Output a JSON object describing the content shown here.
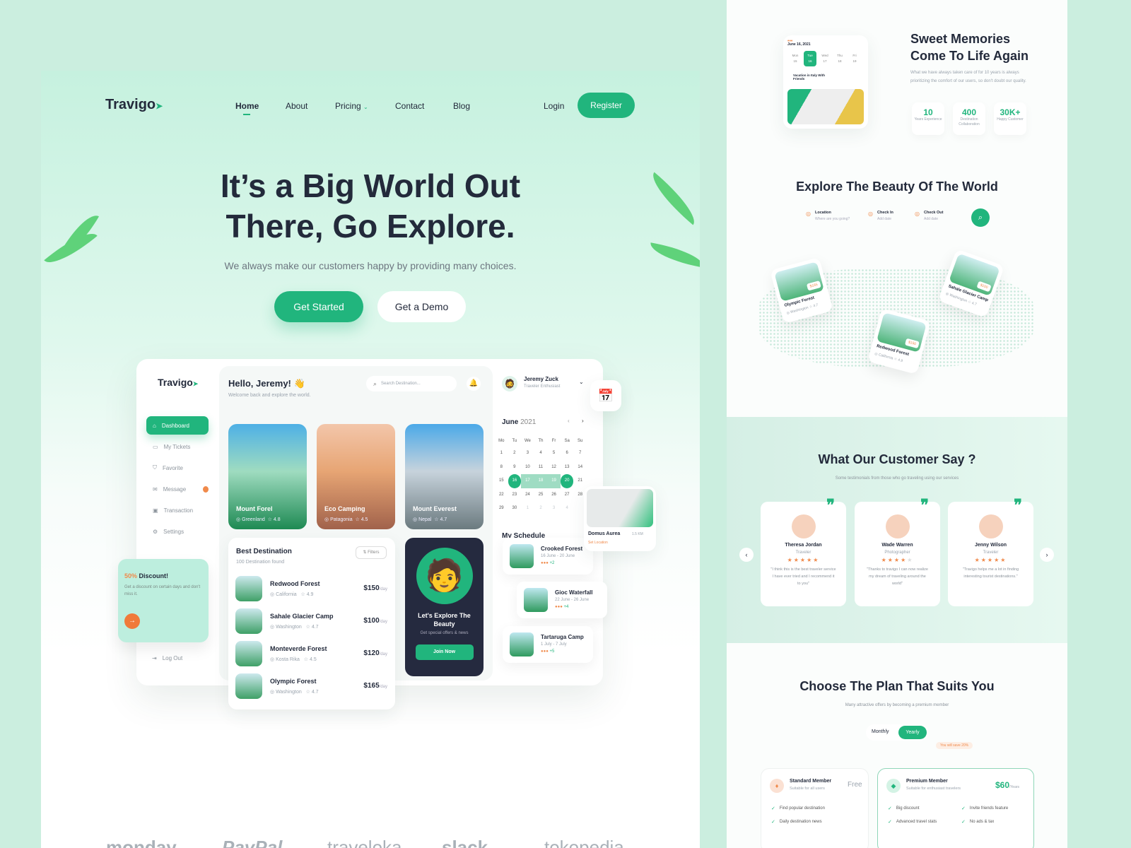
{
  "colors": {
    "accent": "#21b57d",
    "orange": "#f08a4b",
    "dark": "#232a3b",
    "promo_bg": "#252a3f"
  },
  "nav": {
    "brand": "Travigo",
    "links": [
      {
        "label": "Home"
      },
      {
        "label": "About"
      },
      {
        "label": "Pricing"
      },
      {
        "label": "Contact"
      },
      {
        "label": "Blog"
      }
    ],
    "login": "Login",
    "register": "Register"
  },
  "hero": {
    "title_line1": "It’s a Big World Out",
    "title_line2": "There, Go Explore.",
    "subtitle": "We always make our customers happy by providing many choices.",
    "cta_primary": "Get Started",
    "cta_secondary": "Get a Demo"
  },
  "dashboard": {
    "brand": "Travigo",
    "sidebar": [
      {
        "label": "Dashboard",
        "icon": "home-icon"
      },
      {
        "label": "My Tickets",
        "icon": "ticket-icon"
      },
      {
        "label": "Favorite",
        "icon": "bookmark-icon"
      },
      {
        "label": "Message",
        "icon": "message-icon"
      },
      {
        "label": "Transaction",
        "icon": "wallet-icon"
      },
      {
        "label": "Settings",
        "icon": "gear-icon"
      }
    ],
    "logout": "Log Out",
    "discount": {
      "percent": "50%",
      "title": "Discount!",
      "text": "Get a discount on certain days and don't miss it."
    },
    "greeting": "Hello, Jeremy! 👋",
    "welcome": "Welcome back and explore the world.",
    "search_placeholder": "Search Destination...",
    "cards": [
      {
        "name": "Mount Forel",
        "location": "Greenland",
        "rating": "4.8"
      },
      {
        "name": "Eco Camping",
        "location": "Patagonia",
        "rating": "4.5"
      },
      {
        "name": "Mount Everest",
        "location": "Nepal",
        "rating": "4.7"
      }
    ],
    "best": {
      "title": "Best Destination",
      "count": "100 Destination found",
      "filter": "Filters",
      "items": [
        {
          "name": "Redwood Forest",
          "location": "California",
          "rating": "4.9",
          "price": "$150",
          "unit": "/day"
        },
        {
          "name": "Sahale Glacier Camp",
          "location": "Washington",
          "rating": "4.7",
          "price": "$100",
          "unit": "/day"
        },
        {
          "name": "Monteverde Forest",
          "location": "Kosta Rika",
          "rating": "4.5",
          "price": "$120",
          "unit": "/day"
        },
        {
          "name": "Olympic Forest",
          "location": "Washington",
          "rating": "4.7",
          "price": "$165",
          "unit": "/day"
        }
      ]
    },
    "promo": {
      "title": "Let's Explore The Beauty",
      "subtitle": "Get special offers & news",
      "button": "Join Now"
    },
    "profile": {
      "name": "Jeremy Zuck",
      "role": "Traveler Enthusiast"
    },
    "calendar": {
      "month": "June",
      "year": "2021",
      "weekdays": [
        "Mo",
        "Tu",
        "We",
        "Th",
        "Fr",
        "Sa",
        "Su"
      ],
      "days": [
        "1",
        "2",
        "3",
        "4",
        "5",
        "6",
        "7",
        "8",
        "9",
        "10",
        "11",
        "12",
        "13",
        "14",
        "15",
        "16",
        "17",
        "18",
        "19",
        "20",
        "21",
        "22",
        "23",
        "24",
        "25",
        "26",
        "27",
        "28",
        "29",
        "30",
        "1",
        "2",
        "3",
        "4"
      ],
      "selected_range": [
        "16",
        "20"
      ]
    },
    "map_card": {
      "name": "Domus Aurea",
      "distance": "1.5 KM",
      "action": "Set Location"
    },
    "schedule": {
      "title": "My Schedule",
      "items": [
        {
          "name": "Crooked Forest",
          "dates": "16 June - 20 June",
          "more": "+2"
        },
        {
          "name": "Gioc Waterfall",
          "dates": "22 June - 26 June",
          "more": "+4"
        },
        {
          "name": "Tartaruga Camp",
          "dates": "1 July - 7 July",
          "more": "+5"
        }
      ]
    }
  },
  "brands": [
    "monday",
    "PayPal",
    "traveloka",
    "slack",
    "tokopedia"
  ],
  "memories": {
    "title_line1": "Sweet Memories",
    "title_line2": "Come To Life Again",
    "text": "What we have always taken care of for 10 years is always prioritizing the comfort of our users, so don't doubt our quality.",
    "stats": [
      {
        "value": "10",
        "label": "Years Experience"
      },
      {
        "value": "400",
        "label": "Destination Collaboration"
      },
      {
        "value": "30K+",
        "label": "Happy Customer"
      }
    ],
    "mini": {
      "date": "June 16, 2021",
      "days": [
        {
          "d": "Mon",
          "n": "15"
        },
        {
          "d": "Tue",
          "n": "16"
        },
        {
          "d": "Wed",
          "n": "17"
        },
        {
          "d": "Thu",
          "n": "18"
        },
        {
          "d": "Fri",
          "n": "19"
        }
      ],
      "event": "Vacation in Italy With Friends"
    }
  },
  "explore": {
    "title": "Explore The Beauty Of The World",
    "fields": [
      {
        "label": "Location",
        "placeholder": "Where are you going?"
      },
      {
        "label": "Check In",
        "placeholder": "Add date"
      },
      {
        "label": "Check Out",
        "placeholder": "Add date"
      }
    ],
    "map_cards": [
      {
        "name": "Olympic Forest",
        "location": "Washington",
        "rating": "4.7",
        "price": "$165"
      },
      {
        "name": "Sahale Glacier Camp",
        "location": "Washington",
        "rating": "4.7",
        "price": "$100"
      },
      {
        "name": "Redwood Forest",
        "location": "California",
        "rating": "4.9",
        "price": "$150"
      }
    ]
  },
  "testimonials": {
    "title": "What Our Customer Say ?",
    "subtitle": "Some testimonials from those who go traveling using our services",
    "items": [
      {
        "name": "Theresa Jordan",
        "role": "Traveler",
        "stars": 5,
        "text": "\"I think this is the best traveler service I have ever tried and I recommend it to you\""
      },
      {
        "name": "Wade Warren",
        "role": "Photographer",
        "stars": 4,
        "text": "\"Thanks to travigo I can now realize my dream of traveling around the world\""
      },
      {
        "name": "Jenny Wilson",
        "role": "Traveler",
        "stars": 5,
        "text": "\"Travigo helps me a lot in finding interesting tourist destinations.\""
      }
    ]
  },
  "pricing": {
    "title": "Choose The Plan That Suits You",
    "subtitle": "Many attractive offers by becoming a premium member",
    "toggle": [
      "Monthly",
      "Yearly"
    ],
    "save_note": "You will save 20%",
    "plans": [
      {
        "name": "Standard Member",
        "desc": "Suitable for all users",
        "price": "Free",
        "unit": "",
        "features": [
          "Find popular destination",
          "Daily destination news"
        ]
      },
      {
        "name": "Premium Member",
        "desc": "Suitable for enthusiast travelers",
        "price": "$60",
        "unit": "/Years",
        "features": [
          "Big discount",
          "Invite friends feature",
          "Advanced travel stats",
          "No ads & tax"
        ]
      }
    ]
  }
}
